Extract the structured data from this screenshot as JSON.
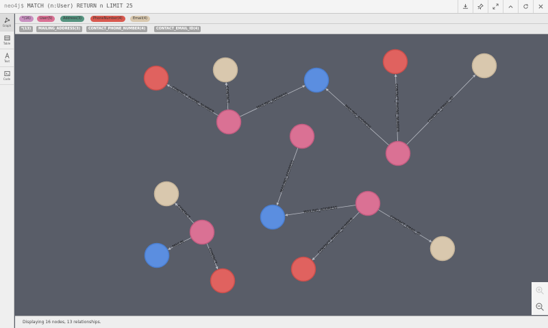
{
  "header": {
    "prompt": "neo4j$",
    "query": "MATCH (n:User) RETURN n LIMIT 25"
  },
  "window_buttons": [
    "download-icon",
    "pin-icon",
    "fullscreen-icon",
    "collapse-icon",
    "rerun-icon",
    "close-icon"
  ],
  "views": [
    {
      "label": "Graph",
      "icon": "graph-icon",
      "active": true
    },
    {
      "label": "Table",
      "icon": "table-icon",
      "active": false
    },
    {
      "label": "Text",
      "icon": "text-icon",
      "active": false
    },
    {
      "label": "Code",
      "icon": "code-icon",
      "active": false
    }
  ],
  "node_labels": [
    {
      "text": "*(16)",
      "color": "#c990c0"
    },
    {
      "text": "User(5)",
      "color": "#da7194"
    },
    {
      "text": "Address(3)",
      "color": "#569480"
    },
    {
      "text": "PhoneNumber(4)",
      "color": "#d9594f"
    },
    {
      "text": "Email(4)",
      "color": "#d9c8ae"
    }
  ],
  "relationship_types": [
    "*(13)",
    "MAILING_ADDRESS(3)",
    "CONTACT_PHONE_NUMBER(4)",
    "CONTACT_EMAIL_ID(4)"
  ],
  "colors": {
    "user": "#da7194",
    "address": "#5b8ee0",
    "phone": "#e0625f",
    "email": "#d9c8ae"
  },
  "graph": {
    "nodes": [
      {
        "id": "u1",
        "type": "user"
      },
      {
        "id": "u2",
        "type": "user"
      },
      {
        "id": "u3",
        "type": "user"
      },
      {
        "id": "u4",
        "type": "user"
      },
      {
        "id": "u5",
        "type": "user"
      },
      {
        "id": "a1",
        "type": "address"
      },
      {
        "id": "a2",
        "type": "address"
      },
      {
        "id": "a3",
        "type": "address"
      },
      {
        "id": "p1",
        "type": "phone"
      },
      {
        "id": "p2",
        "type": "phone"
      },
      {
        "id": "p3",
        "type": "phone"
      },
      {
        "id": "p4",
        "type": "phone"
      },
      {
        "id": "e1",
        "type": "email"
      },
      {
        "id": "e2",
        "type": "email"
      },
      {
        "id": "e3",
        "type": "email"
      },
      {
        "id": "e4",
        "type": "email"
      }
    ],
    "edges": [
      {
        "from": "u1",
        "to": "p1",
        "label": "CONTACT_PHONE_NUMBER"
      },
      {
        "from": "u1",
        "to": "e1",
        "label": "CONTACT..."
      },
      {
        "from": "u1",
        "to": "a1",
        "label": "MAILING_ADDRESS"
      },
      {
        "from": "u2",
        "to": "p2",
        "label": "CONTACT_PHONE_NUMBER"
      },
      {
        "from": "u2",
        "to": "e2",
        "label": "CONTACT_EMAIL_ID"
      },
      {
        "from": "u2",
        "to": "a1",
        "label": "MAILING_ADDRESS"
      },
      {
        "from": "u3",
        "to": "a2",
        "label": "MAILING_ADDRESS"
      },
      {
        "from": "u4",
        "to": "a2",
        "label": "MAILING_ADDRESS"
      },
      {
        "from": "u4",
        "to": "p3",
        "label": "CONTACT_PHONE_NUMBER"
      },
      {
        "from": "u4",
        "to": "e3",
        "label": "CONTACT_EMAIL_ID"
      },
      {
        "from": "u5",
        "to": "e4",
        "label": "CONTACT..."
      },
      {
        "from": "u5",
        "to": "a3",
        "label": "MAILIN..."
      },
      {
        "from": "u5",
        "to": "p4",
        "label": "CONTACT"
      }
    ]
  },
  "status": "Displaying 16 nodes, 13 relationships."
}
